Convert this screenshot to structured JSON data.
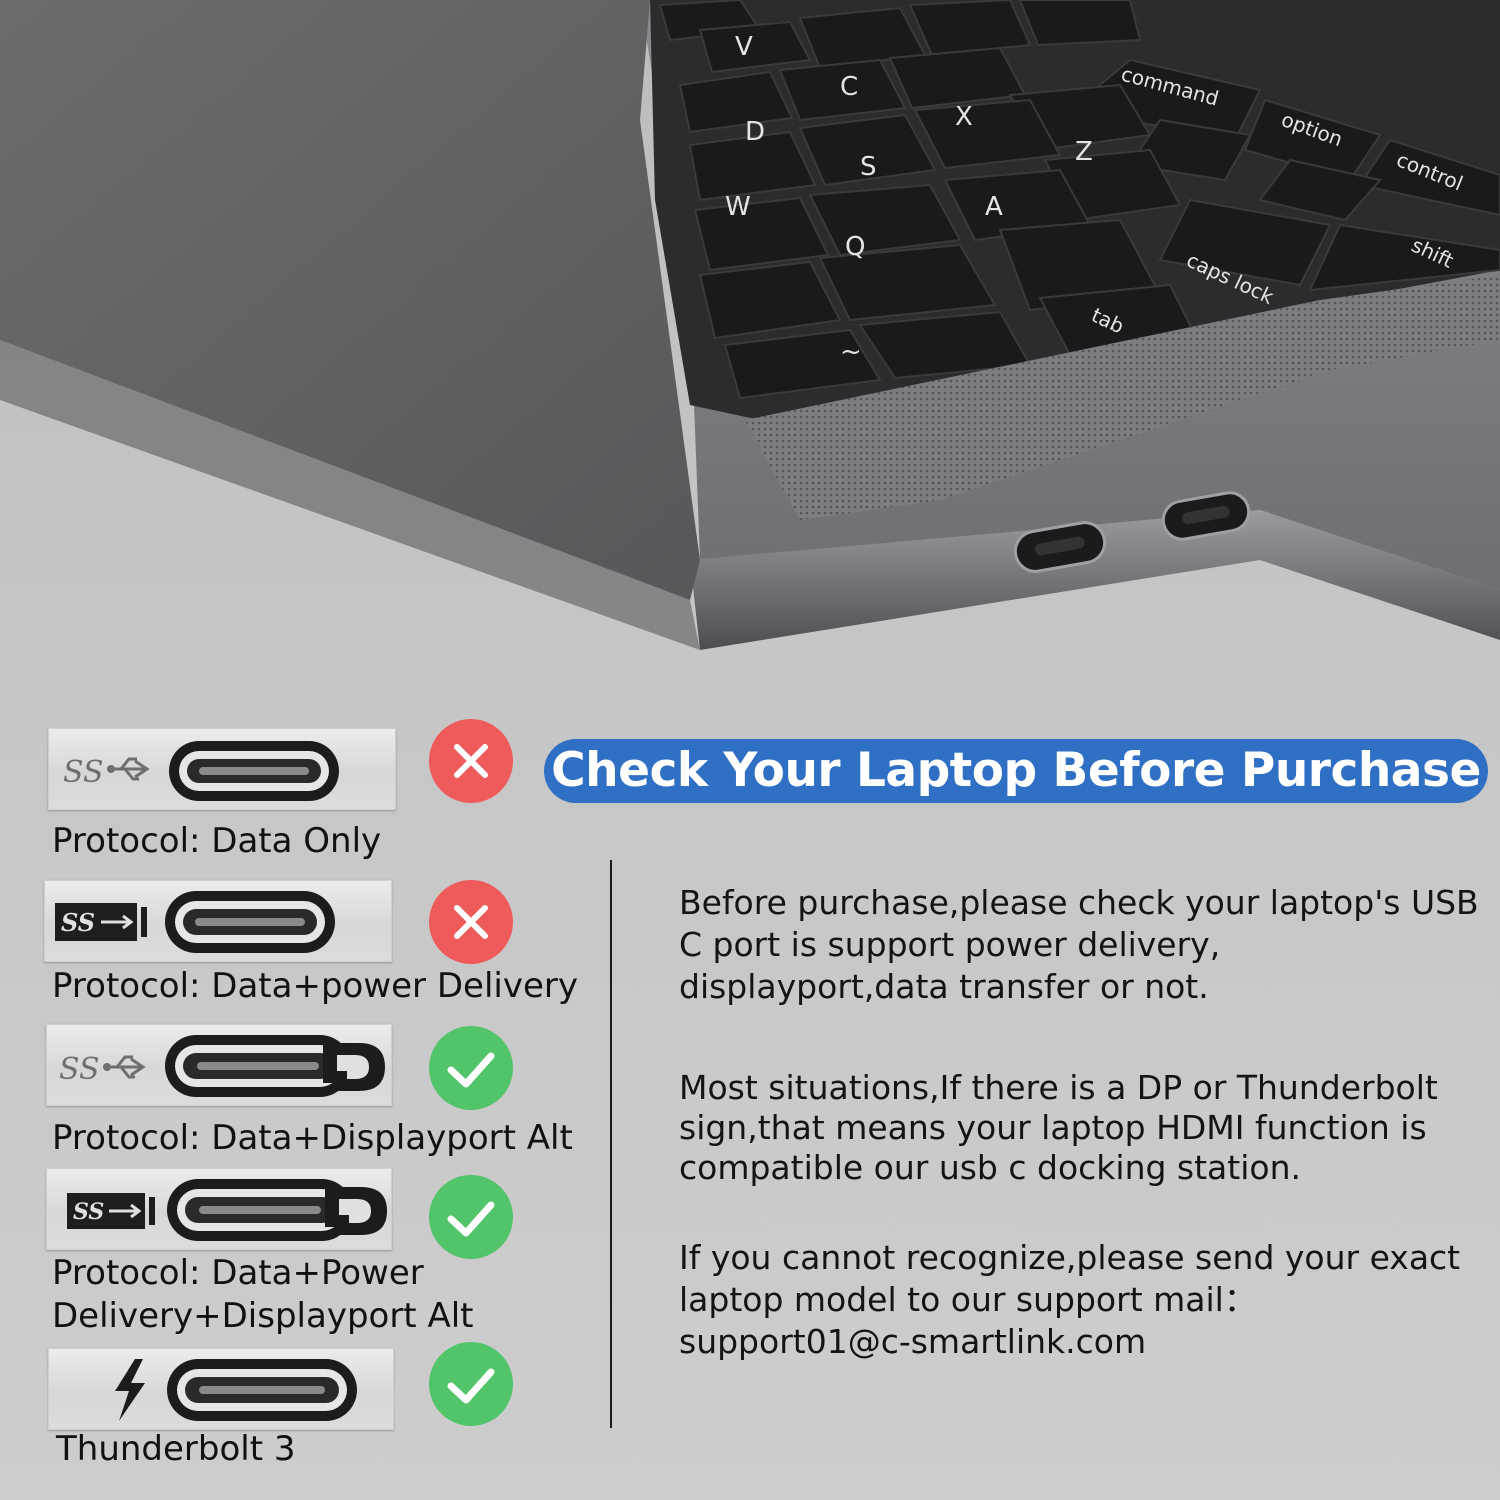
{
  "banner": {
    "title": "Check Your Laptop Before Purchase"
  },
  "keyboard": {
    "keys": [
      "command",
      "option",
      "control",
      "shift",
      "caps lock",
      "tab",
      "Z",
      "X",
      "C",
      "V",
      "A",
      "S",
      "D",
      "Q",
      "W",
      "~"
    ]
  },
  "ports": [
    {
      "logo": "ss-usb-icon",
      "protocol": "Protocol: Data Only",
      "supported": false
    },
    {
      "logo": "ss-usb-power-icon",
      "protocol": "Protocol: Data+power Delivery",
      "supported": false
    },
    {
      "logo": "ss-usb-displayport-icon",
      "protocol": "Protocol: Data+Displayport Alt",
      "supported": true
    },
    {
      "logo": "ss-usb-power-displayport-icon",
      "protocol_line1": "Protocol: Data+Power",
      "protocol_line2": "Delivery+Displayport Alt",
      "supported": true
    },
    {
      "logo": "thunderbolt-icon",
      "protocol": "Thunderbolt 3",
      "supported": true
    }
  ],
  "info": {
    "p1": "Before purchase,please check your laptop's USB C port is support power delivery, displayport,data transfer or not.",
    "p2": "Most situations,If there is a DP or Thunderbolt sign,that means your laptop HDMI function is compatible our usb c docking station.",
    "p3_line1": "If you cannot recognize,please send your exact laptop model to our support mail：",
    "p3_email": "support01@c-smartlink.com"
  },
  "colors": {
    "banner": "#2f6fc4",
    "unsupported": "#ef5b5b",
    "supported": "#52c46a"
  }
}
